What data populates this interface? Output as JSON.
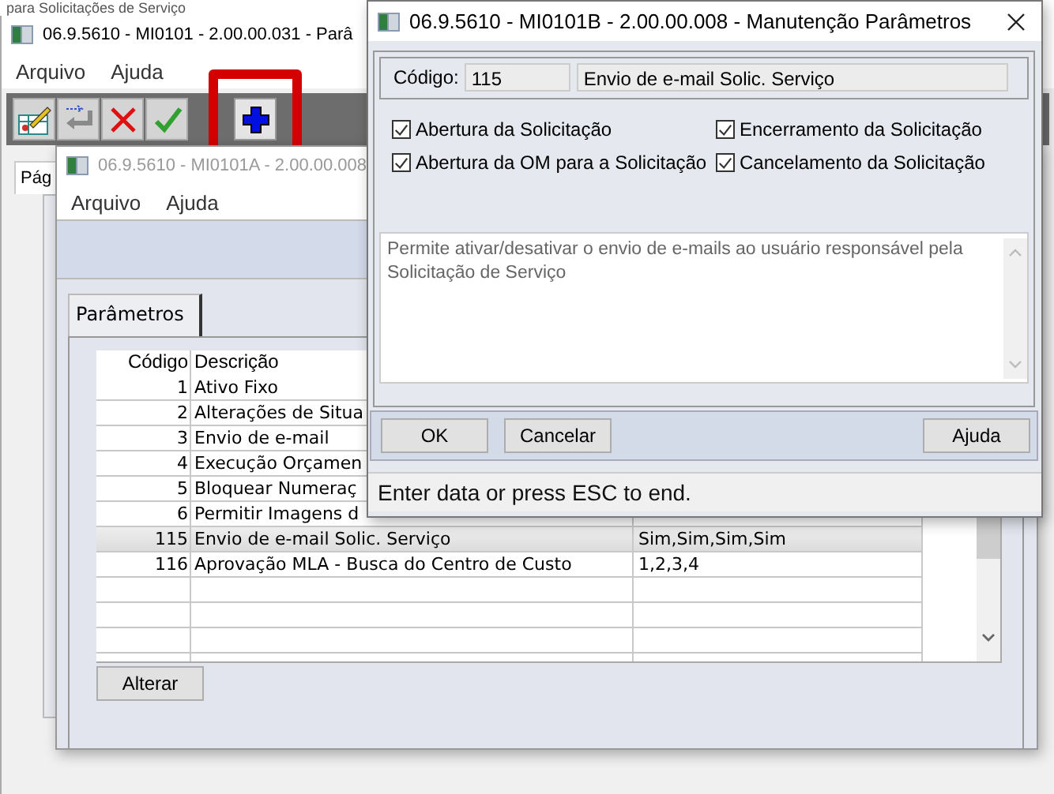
{
  "background_text": "para Solicitações de Serviço",
  "main_window": {
    "title": "06.9.5610 - MI0101 - 2.00.00.031 - Parâ",
    "menu": [
      "Arquivo",
      "Ajuda"
    ],
    "toolbar": [
      {
        "kind": "edit",
        "highlighted": false
      },
      {
        "kind": "return",
        "highlighted": false
      },
      {
        "kind": "delete",
        "highlighted": false
      },
      {
        "kind": "confirm",
        "highlighted": false
      },
      {
        "kind": "add",
        "highlighted": true
      }
    ],
    "tab": "Pág"
  },
  "list_window": {
    "title": "06.9.5610 - MI0101A - 2.00.00.008",
    "menu": [
      "Arquivo",
      "Ajuda"
    ],
    "tabs": [
      {
        "label": "Parâmetros",
        "selected": true
      }
    ],
    "table": {
      "columns": [
        "Código",
        "Descrição"
      ],
      "rows": [
        {
          "code": "1",
          "description": "Ativo Fixo",
          "selected": false
        },
        {
          "code": "2",
          "description": "Alterações de Situa",
          "selected": false
        },
        {
          "code": "3",
          "description": "Envio de e-mail",
          "selected": false
        },
        {
          "code": "4",
          "description": "Execução Orçamen",
          "selected": false
        },
        {
          "code": "5",
          "description": "Bloquear Numeraç",
          "selected": false
        },
        {
          "code": "6",
          "description": "Permitir Imagens d",
          "selected": false
        },
        {
          "code": "115",
          "description": "Envio de e-mail Solic. Serviço",
          "value": "Sim,Sim,Sim,Sim",
          "selected": true
        },
        {
          "code": "116",
          "description": "Aprovação MLA - Busca do Centro de Custo",
          "value": "1,2,3,4",
          "selected": false
        }
      ]
    },
    "buttons": [
      "Alterar"
    ]
  },
  "dialog": {
    "title": "06.9.5610 - MI0101B - 2.00.00.008 - Manutenção Parâmetros",
    "code_label": "Código:",
    "code_value": "115",
    "description_value": "Envio de e-mail Solic. Serviço",
    "checkboxes": [
      {
        "label": "Abertura da Solicitação",
        "checked": true
      },
      {
        "label": "Encerramento da Solicitação",
        "checked": true
      },
      {
        "label": "Abertura da OM para a Solicitação",
        "checked": true
      },
      {
        "label": "Cancelamento da Solicitação",
        "checked": true
      }
    ],
    "help_text": "Permite ativar/desativar o envio de e-mails ao usuário responsável pela Solicitação de Serviço",
    "buttons": [
      "OK",
      "Cancelar",
      "Ajuda"
    ],
    "status": "Enter data or press ESC to end."
  }
}
